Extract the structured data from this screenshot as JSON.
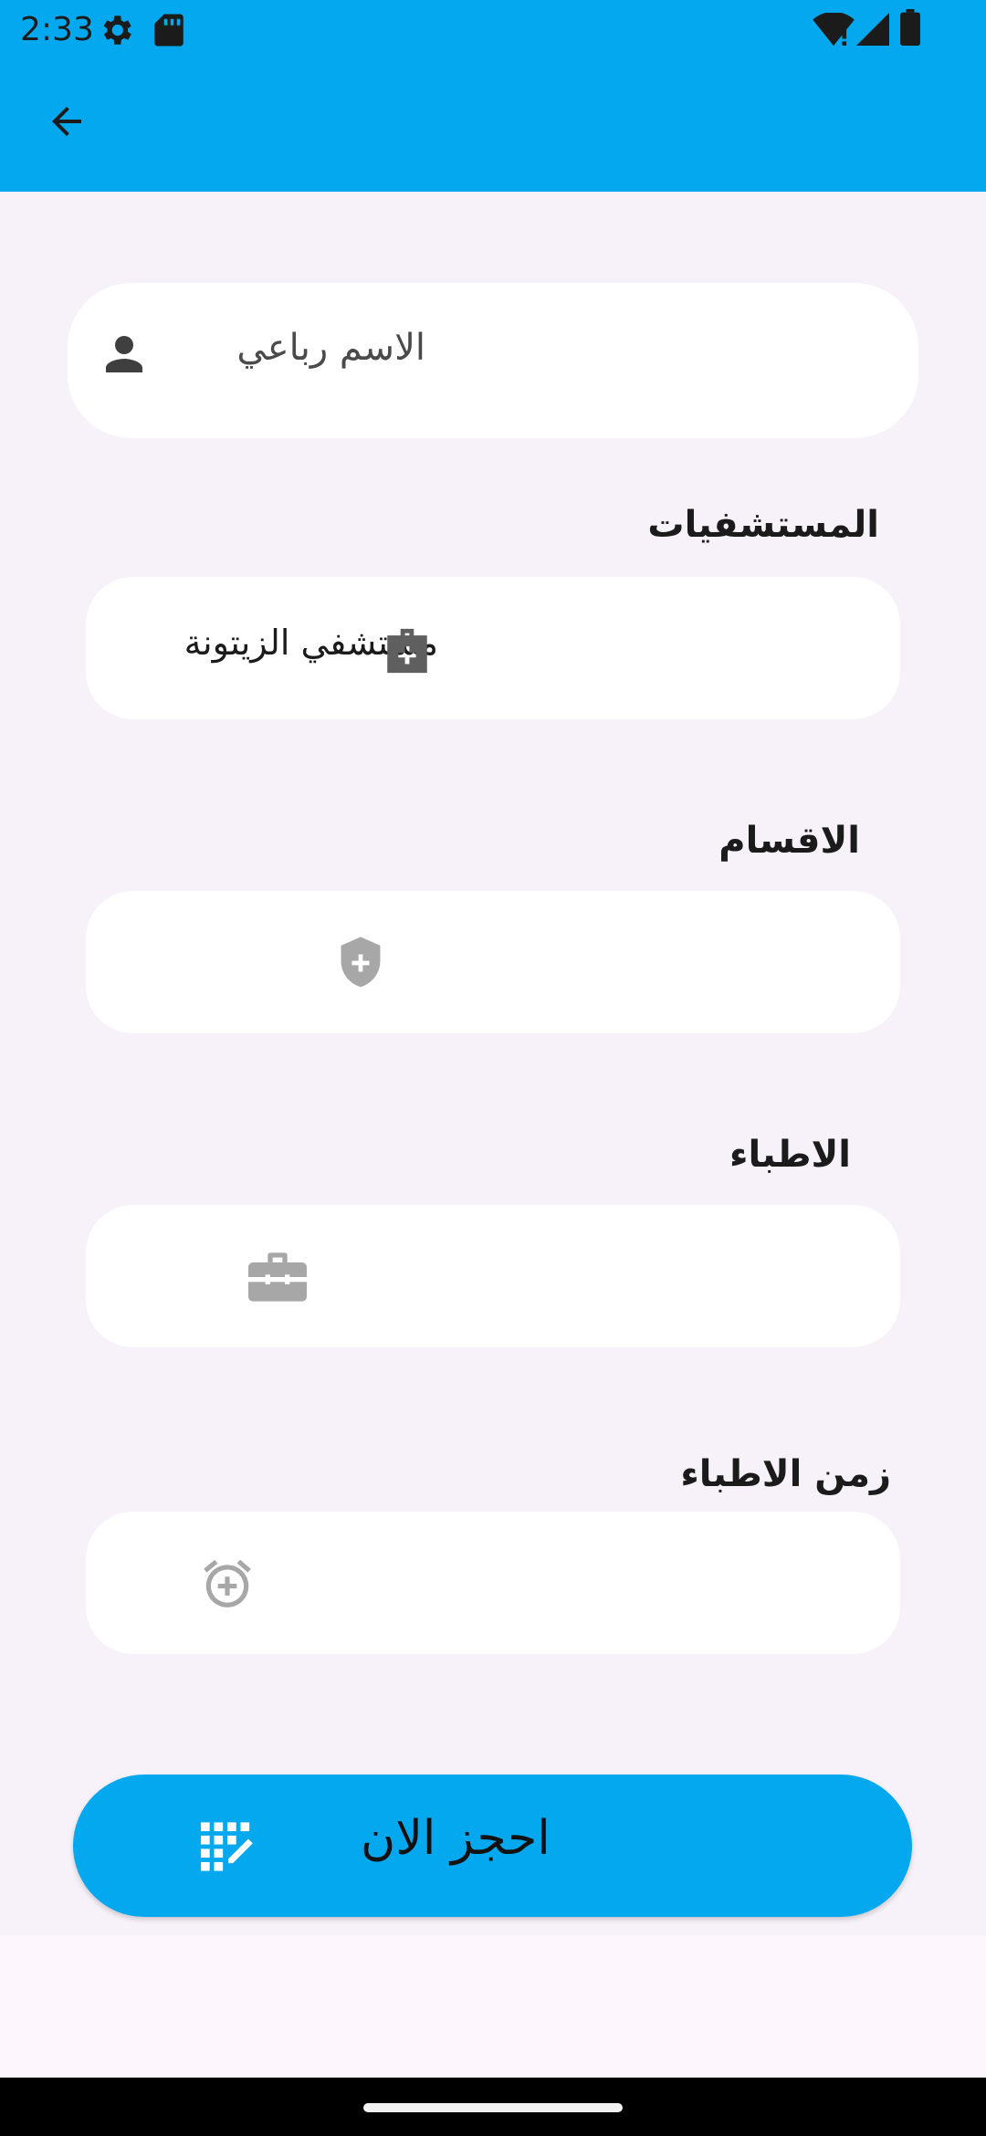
{
  "status_bar": {
    "time": "2:33",
    "icons": [
      "settings-gear-icon",
      "sd-card-icon",
      "wifi-icon",
      "signal-icon",
      "battery-icon"
    ]
  },
  "app_bar": {
    "back_icon": "arrow-back-icon",
    "background_color": "#04a8ef"
  },
  "form": {
    "name_field": {
      "placeholder": "الاسم رباعي",
      "icon": "person-icon"
    },
    "hospitals": {
      "label": "المستشفيات",
      "selected": "مستشفي الزيتونة",
      "icon": "medical-bag-icon"
    },
    "departments": {
      "label": "الاقسام",
      "selected": "",
      "icon": "shield-plus-icon"
    },
    "doctors": {
      "label": "الاطباء",
      "selected": "",
      "icon": "briefcase-icon"
    },
    "doctor_time": {
      "label": "زمن الاطباء",
      "selected": "",
      "icon": "alarm-add-icon"
    }
  },
  "book_button": {
    "label": "احجز الان",
    "icon": "grid-edit-icon"
  }
}
